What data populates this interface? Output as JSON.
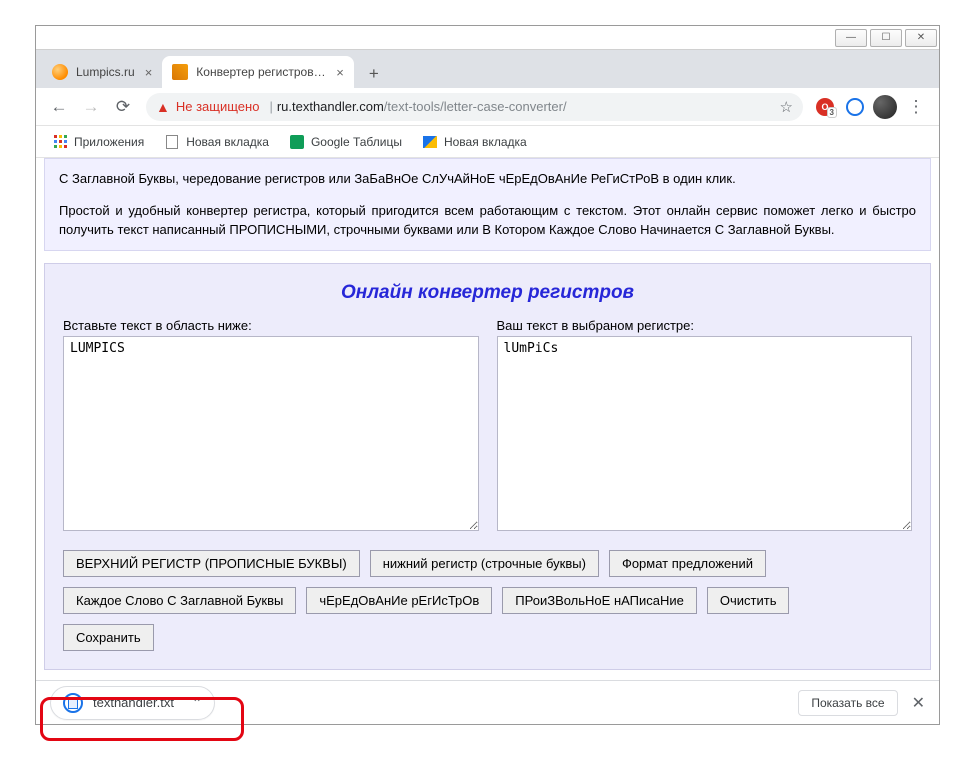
{
  "window_controls": {
    "minimize": "—",
    "maximize": "☐",
    "close": "✕"
  },
  "tabs": [
    {
      "title": "Lumpics.ru",
      "active": false
    },
    {
      "title": "Конвертер регистров - конверт",
      "active": true
    }
  ],
  "newtab_glyph": "+",
  "nav": {
    "back": "←",
    "forward": "→",
    "reload": "⟳"
  },
  "omnibox": {
    "warning_text": "Не защищено",
    "url_host": "ru.texthandler.com",
    "url_path": "/text-tools/letter-case-converter/",
    "star": "☆"
  },
  "ext_badge": "3",
  "menu_glyph": "⋮",
  "bookmarks": [
    {
      "label": "Приложения",
      "kind": "apps"
    },
    {
      "label": "Новая вкладка",
      "kind": "file"
    },
    {
      "label": "Google Таблицы",
      "kind": "gdoc"
    },
    {
      "label": "Новая вкладка",
      "kind": "img"
    }
  ],
  "page": {
    "top_text_1": "С Заглавной Буквы, чередование регистров или ЗаБаВнОе СлУчАйНоЕ чЕрЕдОвАнИе РеГиСтРоВ в один клик.",
    "top_text_2": "Простой и удобный конвертер регистра, который пригодится всем работающим с текстом. Этот онлайн сервис поможет легко и быстро получить текст написанный ПРОПИСНЫМИ, строчными буквами или В Котором Каждое Слово Начинается С Заглавной Буквы.",
    "converter_title": "Онлайн конвертер регистров",
    "input_label": "Вставьте текст в область ниже:",
    "output_label": "Ваш текст в выбраном регистре:",
    "input_value": "LUMPICS",
    "output_value": "lUmPiCs",
    "buttons": {
      "upper": "ВЕРХНИЙ РЕГИСТР (ПРОПИСНЫЕ БУКВЫ)",
      "lower": "нижний регистр (строчные буквы)",
      "sentence": "Формат предложений",
      "titlecase": "Каждое Слово С Заглавной Буквы",
      "alternating": "чЕрЕдОвАнИе рЕгИсТрОв",
      "random": "ПРоиЗВольНоЕ нАПисаНие",
      "clear": "Очистить",
      "save": "Сохранить"
    }
  },
  "download": {
    "filename": "texthandler.txt",
    "chevron": "⌃",
    "show_all": "Показать все",
    "close": "✕"
  }
}
